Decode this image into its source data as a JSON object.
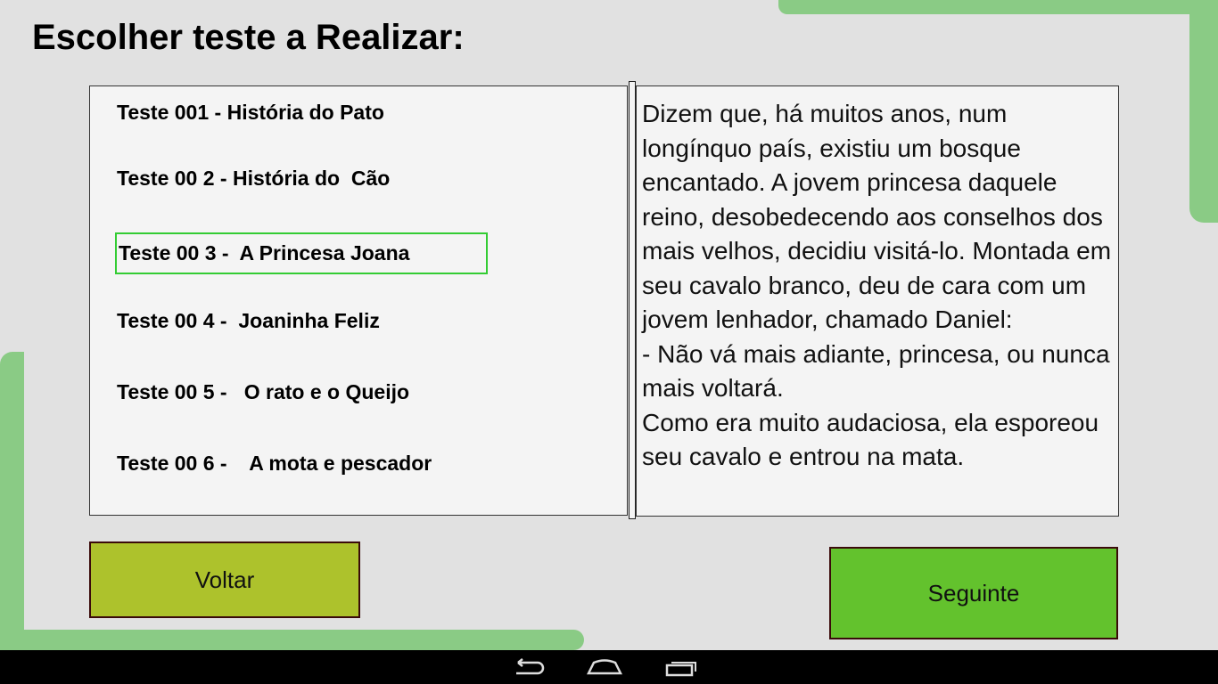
{
  "title": "Escolher teste a Realizar:",
  "tests": [
    {
      "label": "Teste 001 - História do Pato"
    },
    {
      "label": "Teste 00 2 - História do  Cão"
    },
    {
      "label": "Teste 00 3 -  A Princesa Joana"
    },
    {
      "label": "Teste 00 4 -  Joaninha Feliz"
    },
    {
      "label": "Teste 00 5 -   O rato e o Queijo"
    },
    {
      "label": "Teste 00 6 -    A mota e pescador"
    }
  ],
  "selected_index": 2,
  "story_text": "Dizem que, há muitos anos, num longínquo país, existiu um bosque encantado. A jovem princesa daquele reino, desobedecendo aos conselhos dos mais velhos, decidiu visitá-lo. Montada em seu cavalo branco, deu de cara com um jovem lenhador, chamado Daniel:\n- Não vá mais adiante, princesa, ou nunca mais voltará.\nComo era muito audaciosa, ela esporeou seu cavalo e entrou na mata.",
  "buttons": {
    "back": "Voltar",
    "next": "Seguinte"
  },
  "colors": {
    "accent_green": "#8acb85",
    "back_button": "#adc22c",
    "next_button": "#63c22d",
    "selection": "#33cc33"
  }
}
